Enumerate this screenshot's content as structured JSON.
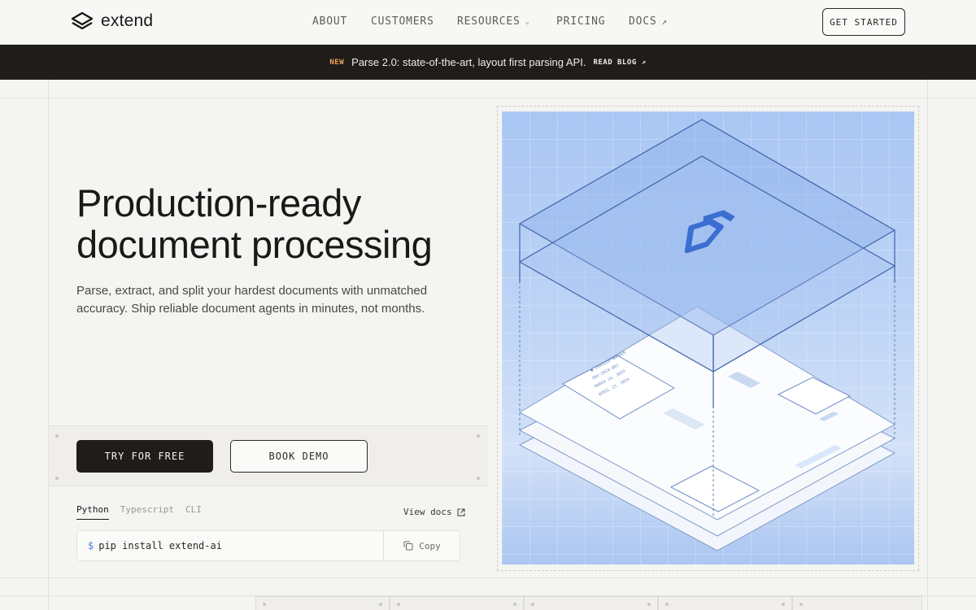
{
  "brand": {
    "name": "extend"
  },
  "nav": {
    "items": [
      {
        "label": "ABOUT"
      },
      {
        "label": "CUSTOMERS"
      },
      {
        "label": "RESOURCES"
      },
      {
        "label": "PRICING"
      },
      {
        "label": "DOCS"
      }
    ],
    "cta": "GET STARTED"
  },
  "banner": {
    "badge": "NEW",
    "message": "Parse 2.0: state-of-the-art, layout first parsing API.",
    "link": "READ BLOG"
  },
  "hero": {
    "title_line1": "Production-ready",
    "title_line2": "document processing",
    "subtitle": "Parse, extract, and split your hardest documents with unmatched accuracy. Ship reliable document agents in minutes, not months.",
    "primary_button": "TRY FOR FREE",
    "secondary_button": "BOOK DEMO"
  },
  "code": {
    "tabs": [
      {
        "label": "Python"
      },
      {
        "label": "Typescript"
      },
      {
        "label": "CLI"
      }
    ],
    "view_docs": "View docs",
    "prompt": "$",
    "command": "pip install extend-ai",
    "copy_label": "Copy"
  },
  "colors": {
    "accent_blue": "#4a7fd6",
    "banner_badge": "#f0a55a",
    "dark": "#1f1c1a"
  }
}
